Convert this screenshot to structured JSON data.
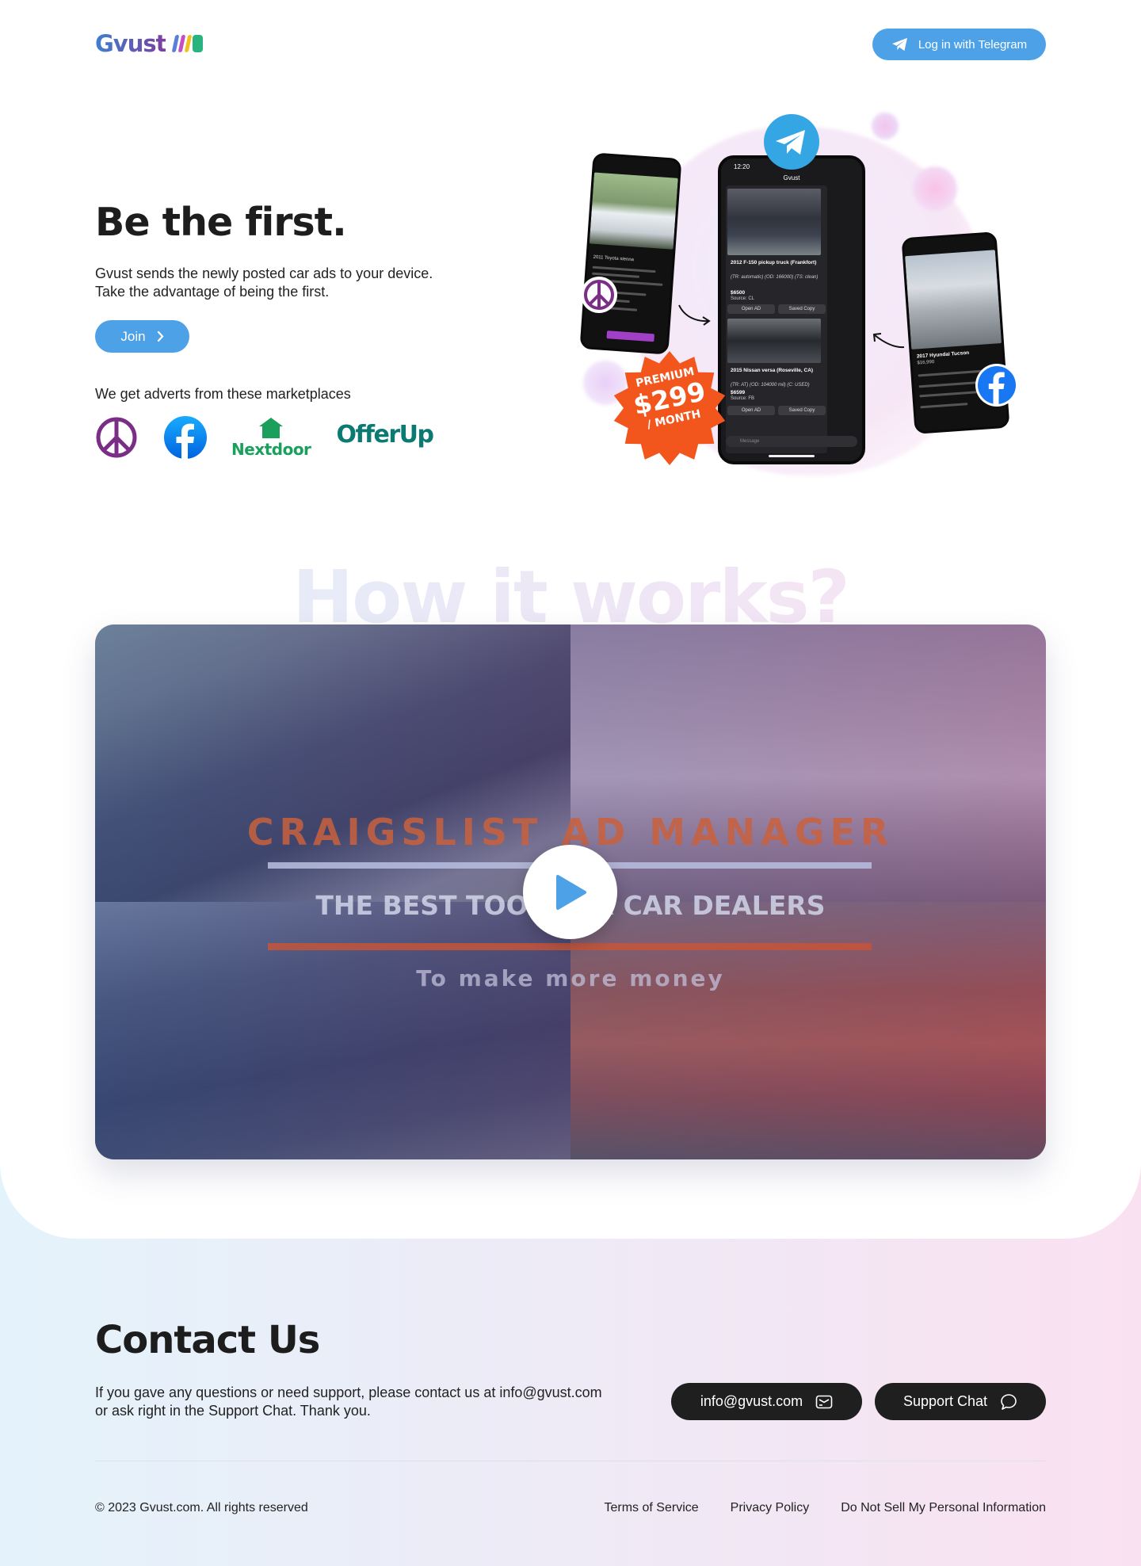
{
  "brand": {
    "name": "Gvust",
    "accent": "#4da1e7"
  },
  "header": {
    "login_label": "Log in with Telegram"
  },
  "hero": {
    "title": "Be the first.",
    "desc_line1": "Gvust sends the newly posted car ads to your device.",
    "desc_line2": "Take the advantage of being the first.",
    "join_label": "Join",
    "marketplaces_label": "We get adverts from these marketplaces",
    "marketplaces": [
      "Craigslist",
      "Facebook",
      "Nextdoor",
      "OfferUp"
    ],
    "nextdoor_word": "Nextdoor",
    "offerup_word": "OfferUp"
  },
  "phone_main": {
    "time": "12:20",
    "chat_title": "Gvust",
    "ad1": {
      "title": "2012 F-150 pickup truck (Frankfort)",
      "details": "(TR: automatic) (OD: 166000) (TS: clean)",
      "price": "$6500",
      "source": "Source: CL"
    },
    "ad2": {
      "title": "2015 Nissan versa (Roseville, CA)",
      "details": "(TR: AT) (OD: 104000 mil) (C: USED)",
      "price": "$6599",
      "source": "Source: FB"
    },
    "open_label": "Open AD",
    "saved_label": "Saved Copy",
    "message_placeholder": "Message"
  },
  "phone_left": {
    "title": "2011 Toyota sienna"
  },
  "phone_right": {
    "title": "2017 Hyundai Tucson",
    "price": "$16,990"
  },
  "badge": {
    "line1": "PREMIUM",
    "price": "$299",
    "line3": "/ MONTH",
    "color": "#f2561d"
  },
  "how": {
    "title": "How it works?"
  },
  "video": {
    "headline": "CRAIGSLIST AD MANAGER",
    "subheadline": "THE BEST TOOL FOR CAR DEALERS",
    "tagline": "To make more money"
  },
  "contact": {
    "title": "Contact Us",
    "desc_line1": "If you gave any questions or need support, please contact us at info@gvust.com",
    "desc_line2": "or ask right in the Support Chat. Thank you.",
    "email_label": "info@gvust.com",
    "chat_label": "Support Chat"
  },
  "footer": {
    "copyright": "© 2023 Gvust.com. All rights reserved",
    "terms": "Terms of Service",
    "privacy": "Privacy Policy",
    "do_not_sell": "Do Not Sell My Personal Information"
  }
}
